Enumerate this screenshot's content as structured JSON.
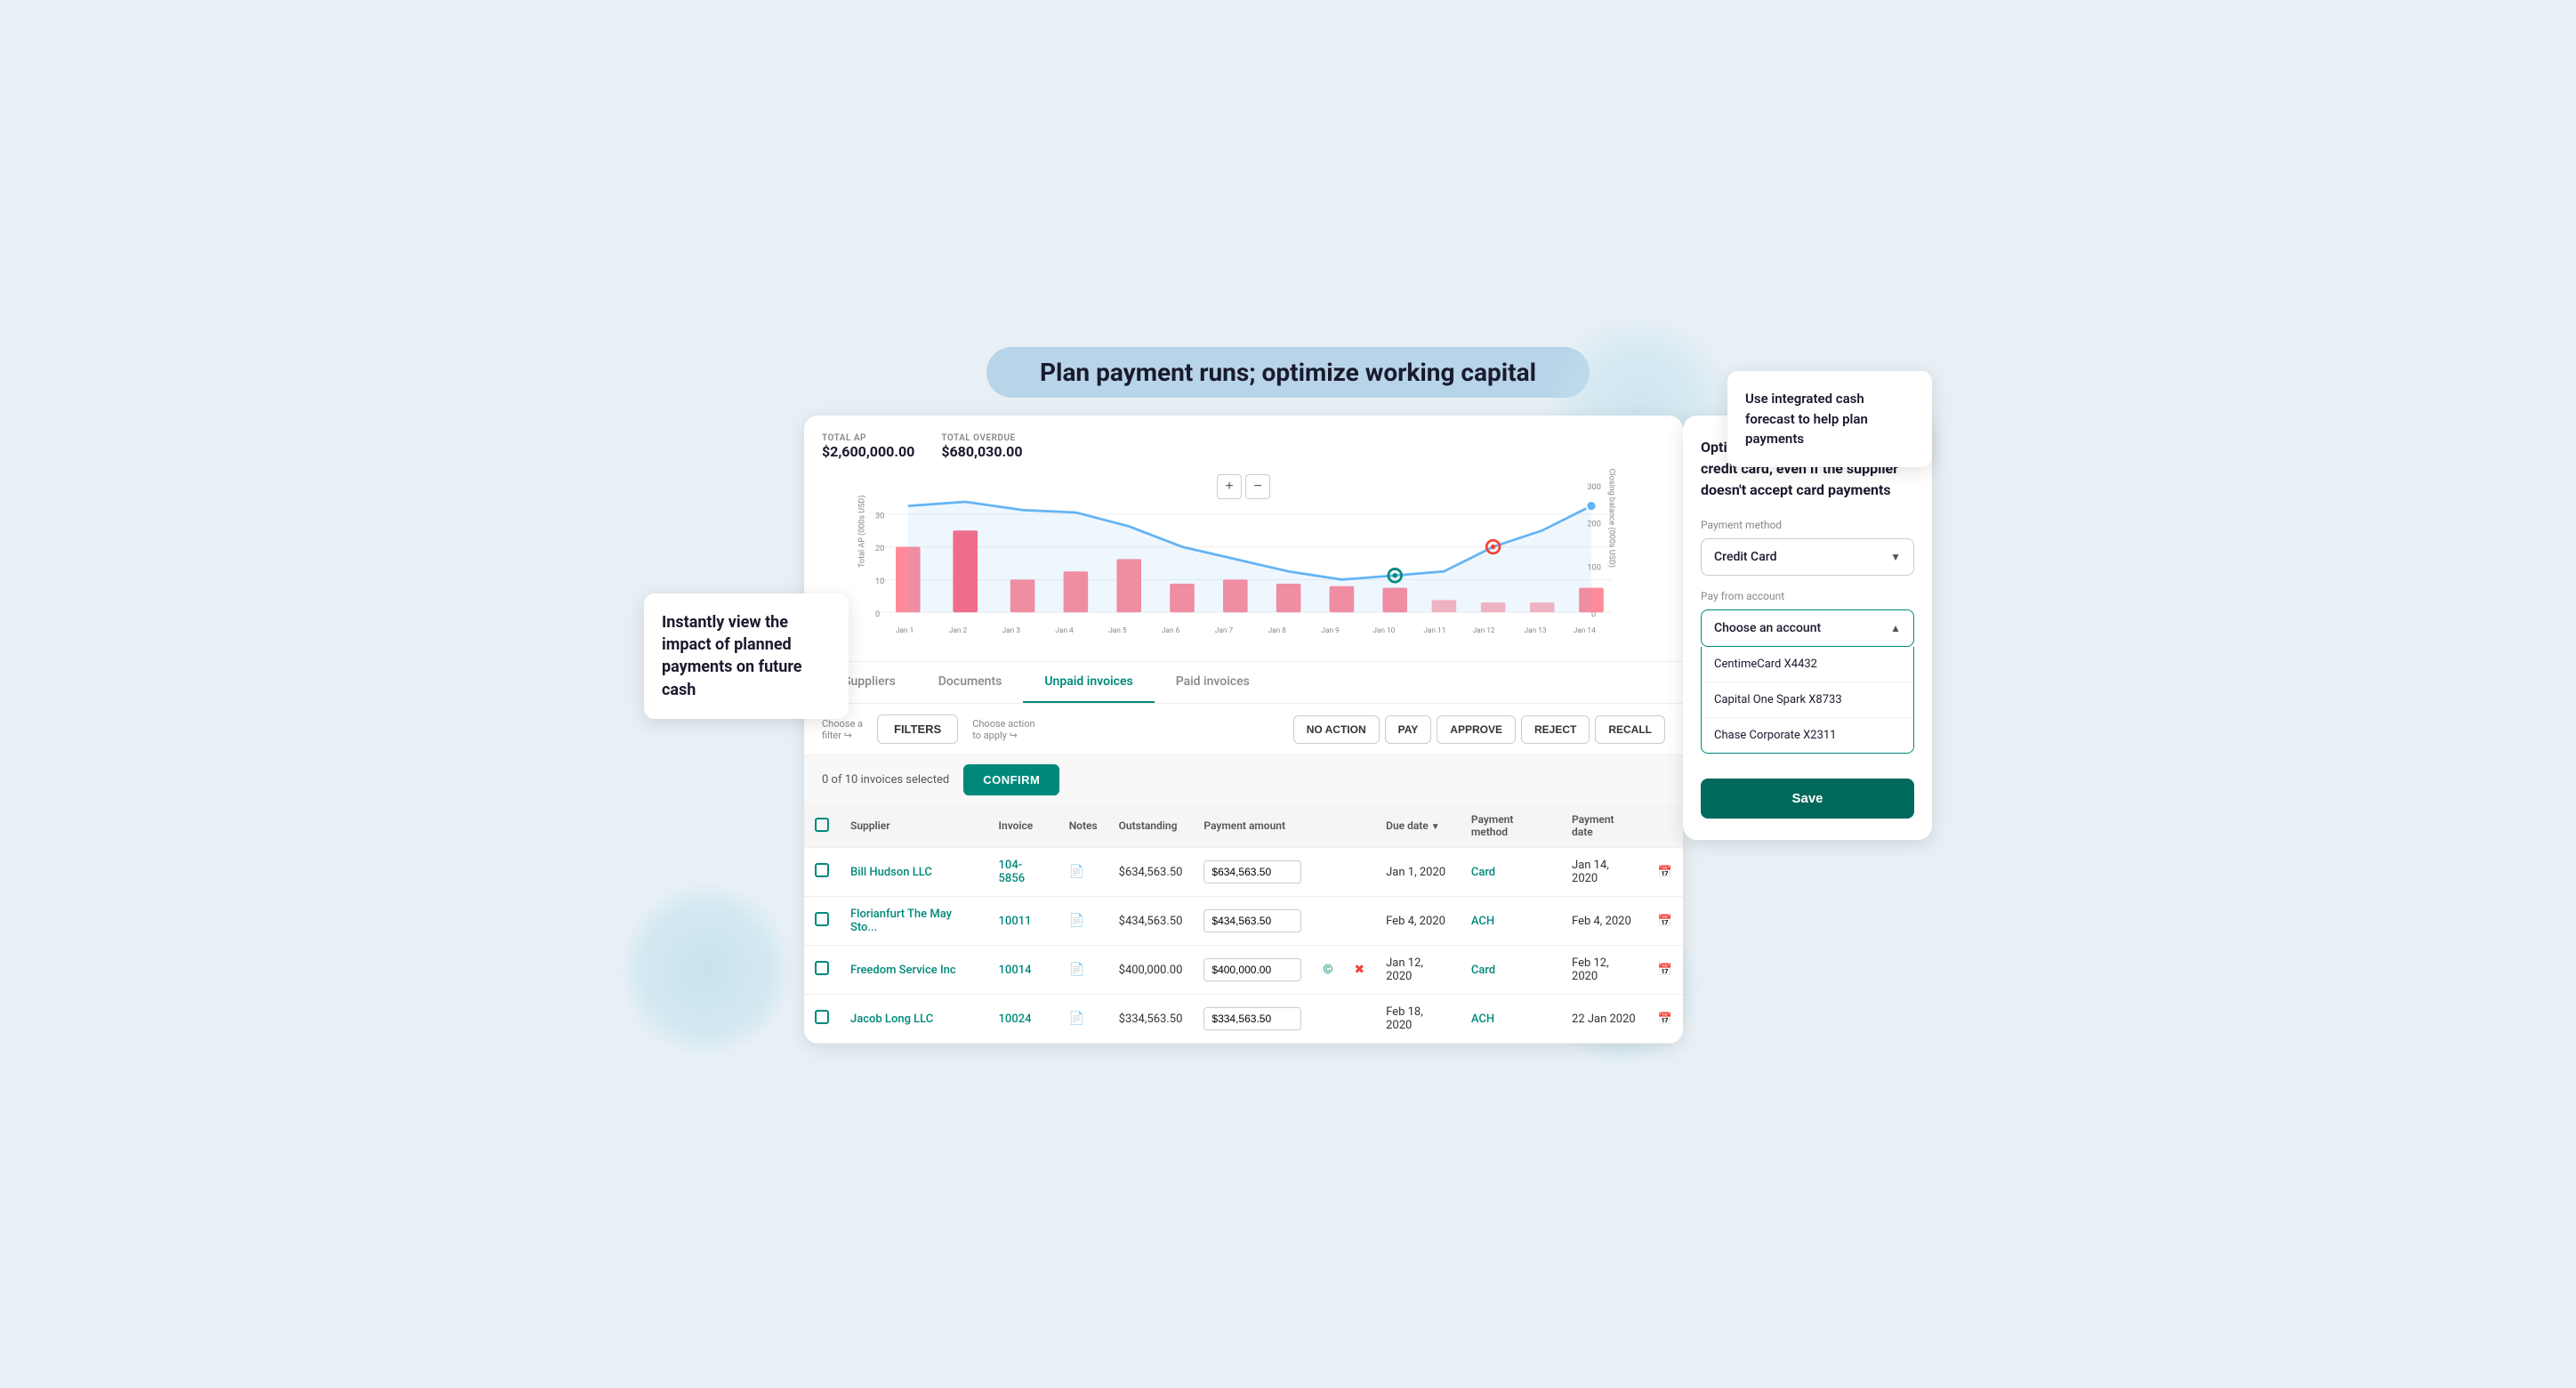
{
  "page": {
    "title": "Plan payment runs; optimize working capital"
  },
  "tooltip_left": {
    "text": "Instantly view the impact of planned payments on future cash"
  },
  "tooltip_top_right": {
    "text": "Use integrated cash forecast to help plan payments"
  },
  "right_panel": {
    "heading": "Optimize cash by paying with credit card, even if the supplier doesn't accept card payments",
    "payment_method_label": "Payment method",
    "payment_method_value": "Credit Card",
    "pay_from_label": "Pay from account",
    "pay_from_placeholder": "Choose an account",
    "options": [
      {
        "id": "centime",
        "label": "CentimeCard X4432"
      },
      {
        "id": "capital",
        "label": "Capital One Spark X8733"
      },
      {
        "id": "chase",
        "label": "Chase Corporate X2311"
      }
    ],
    "save_button": "Save"
  },
  "chart": {
    "y_left_label": "Total AP (000s USD)",
    "y_right_label": "Closing balance (000s USD)",
    "zoom_plus": "+",
    "zoom_minus": "−",
    "x_labels": [
      "Jan 1",
      "Jan 2",
      "Jan 3",
      "Jan 4",
      "Jan 5",
      "Jan 6",
      "Jan 7",
      "Jan 8",
      "Jan 9",
      "Jan 10",
      "Jan 11",
      "Jan 12",
      "Jan 13",
      "Jan 14"
    ],
    "y_ticks_left": [
      "0",
      "10",
      "20",
      "30"
    ],
    "y_ticks_right": [
      "0",
      "100",
      "200",
      "300"
    ],
    "total_ap_label": "TOTAL AP",
    "total_ap_value": "$2,600,000.00",
    "total_overdue_label": "TOTAL OVERDUE",
    "total_overdue_value": "$680,030.00"
  },
  "tabs": [
    {
      "id": "suppliers",
      "label": "Suppliers"
    },
    {
      "id": "documents",
      "label": "Documents"
    },
    {
      "id": "unpaid",
      "label": "Unpaid invoices",
      "active": true
    },
    {
      "id": "paid",
      "label": "Paid invoices"
    }
  ],
  "filters_bar": {
    "choose_filter_label": "Choose a",
    "choose_filter_sub": "filter",
    "filters_button": "FILTERS",
    "choose_action_label": "Choose action",
    "choose_action_sub": "to apply",
    "actions": [
      {
        "id": "no-action",
        "label": "NO ACTION"
      },
      {
        "id": "pay",
        "label": "PAY"
      },
      {
        "id": "approve",
        "label": "APPROVE"
      },
      {
        "id": "reject",
        "label": "REJECT"
      },
      {
        "id": "recall",
        "label": "RECALL"
      }
    ]
  },
  "selection_bar": {
    "count_text": "0 of 10 invoices selected",
    "confirm_button": "CONFIRM"
  },
  "table": {
    "columns": [
      {
        "id": "checkbox",
        "label": ""
      },
      {
        "id": "supplier",
        "label": "Supplier"
      },
      {
        "id": "invoice",
        "label": "Invoice"
      },
      {
        "id": "notes",
        "label": "Notes"
      },
      {
        "id": "outstanding",
        "label": "Outstanding"
      },
      {
        "id": "payment_amount",
        "label": "Payment amount"
      },
      {
        "id": "col6",
        "label": ""
      },
      {
        "id": "col7",
        "label": ""
      },
      {
        "id": "due_date",
        "label": "Due date"
      },
      {
        "id": "payment_method",
        "label": "Payment method"
      },
      {
        "id": "payment_date",
        "label": "Payment date"
      },
      {
        "id": "col_last",
        "label": ""
      }
    ],
    "rows": [
      {
        "supplier": "Bill Hudson LLC",
        "invoice": "104-5856",
        "notes_icon": "📄",
        "outstanding": "$634,563.50",
        "payment_amount": "$634,563.50",
        "icon1": "",
        "icon2": "",
        "due_date": "Jan 1, 2020",
        "payment_method": "Card",
        "payment_date": "Jan 14, 2020",
        "cal_icon": "📅"
      },
      {
        "supplier": "Florianfurt The May Sto...",
        "invoice": "10011",
        "notes_icon": "📄",
        "outstanding": "$434,563.50",
        "payment_amount": "$434,563.50",
        "icon1": "",
        "icon2": "",
        "due_date": "Feb 4, 2020",
        "payment_method": "ACH",
        "payment_date": "Feb 4, 2020",
        "cal_icon": "📅"
      },
      {
        "supplier": "Freedom Service Inc",
        "invoice": "10014",
        "notes_icon": "📄",
        "outstanding": "$400,000.00",
        "payment_amount": "$400,000.00",
        "icon1": "©",
        "icon2": "✖",
        "due_date": "Jan 12, 2020",
        "payment_method": "Card",
        "payment_date": "Feb 12, 2020",
        "cal_icon": "📅"
      },
      {
        "supplier": "Jacob Long LLC",
        "invoice": "10024",
        "notes_icon": "📄",
        "outstanding": "$334,563.50",
        "payment_amount": "$334,563.50",
        "icon1": "",
        "icon2": "",
        "due_date": "Feb 18, 2020",
        "payment_method": "ACH",
        "payment_date": "22 Jan 2020",
        "cal_icon": "📅"
      }
    ]
  }
}
